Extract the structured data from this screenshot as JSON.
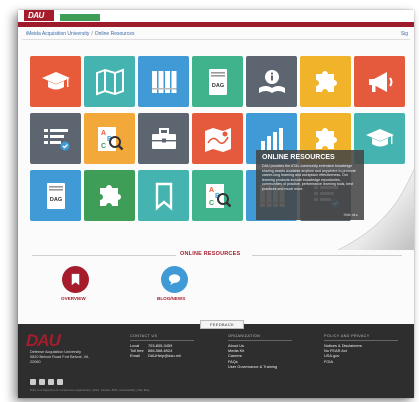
{
  "header": {
    "logo": "DAU",
    "breadcrumb": [
      "iMeida Acquisition University",
      "Online Resources"
    ],
    "right_link": "Sig"
  },
  "tiles": [
    {
      "icon": "graduation-cap-icon",
      "color": "#e85b3a"
    },
    {
      "icon": "map-icon",
      "color": "#45b3b0"
    },
    {
      "icon": "binders-icon",
      "color": "#3f9ad6"
    },
    {
      "icon": "dag-book-icon",
      "color": "#41b38c"
    },
    {
      "icon": "info-book-icon",
      "color": "#5d6670"
    },
    {
      "icon": "puzzle-icon",
      "color": "#f0b32a"
    },
    {
      "icon": "megaphone-icon",
      "color": "#e55a3d"
    },
    {
      "icon": "checklist-icon",
      "color": "#5d6670"
    },
    {
      "icon": "abc-search-icon",
      "color": "#f3a93a"
    },
    {
      "icon": "toolbox-icon",
      "color": "#5d6670"
    },
    {
      "icon": "map-pin-icon",
      "color": "#e55a3d"
    },
    {
      "icon": "chart-icon",
      "color": "#3f9ad6"
    },
    {
      "icon": "puzzle-icon",
      "color": "#f0b32a"
    },
    {
      "icon": "graduation-cap-icon",
      "color": "#45b3b0"
    },
    {
      "icon": "dag-book-icon",
      "color": "#3f9ad6"
    },
    {
      "icon": "puzzle-icon",
      "color": "#3e9d57"
    },
    {
      "icon": "bookmark-icon",
      "color": "#45b3b0"
    },
    {
      "icon": "abc-search-icon",
      "color": "#41b38c"
    },
    {
      "icon": "binders-icon",
      "color": "#3f9ad6"
    },
    {
      "icon": "checklist-icon",
      "color": "#5d6670"
    }
  ],
  "tile_dag_label": "DAG",
  "overlay": {
    "title": "ONLINE RESOURCES",
    "text": "DAU provides the AT&L community extensive knowledge sharing assets available anytime and anywhere to promote career-long learning and workplace effectiveness. Our learning products include knowledge repositories, communities of practice, performance learning tools, best practices and much more.",
    "link": "Hide all ▸"
  },
  "section_heading": "ONLINE RESOURCES",
  "quick_links": [
    {
      "label": "OVERVIEW",
      "icon": "bookmark-icon",
      "color": "#a51d2d"
    },
    {
      "label": "BLOG/NEWS",
      "icon": "chat-bubble-icon",
      "color": "#3f9ad6"
    }
  ],
  "footer": {
    "feedback": "FEEDBACK",
    "logo": "DAU",
    "address": [
      "Defense Acquisition University",
      "9820 Belvoir Road Fort Belvoir, VA",
      "22060"
    ],
    "contact_title": "CONTACT US",
    "contact": [
      {
        "label": "Local",
        "value": "703-805-3459"
      },
      {
        "label": "Toll free",
        "value": "866-568-6924"
      },
      {
        "label": "Email",
        "value": "DAUHelp@dau.mil"
      }
    ],
    "org_title": "ORGANIZATION",
    "org_links": [
      "About Us",
      "Media Kit",
      "Careers",
      "FAQs",
      "User Governance & Training"
    ],
    "policy_title": "POLICY AND PRIVACY",
    "policy_links": [
      "Notices & Disclaimers",
      "No FEAR Act",
      "USA.gov",
      "FOIA"
    ],
    "copyright": "DAU is a Department of Defense organization, 2019. Section 508 | Accessibility | Site Map"
  }
}
